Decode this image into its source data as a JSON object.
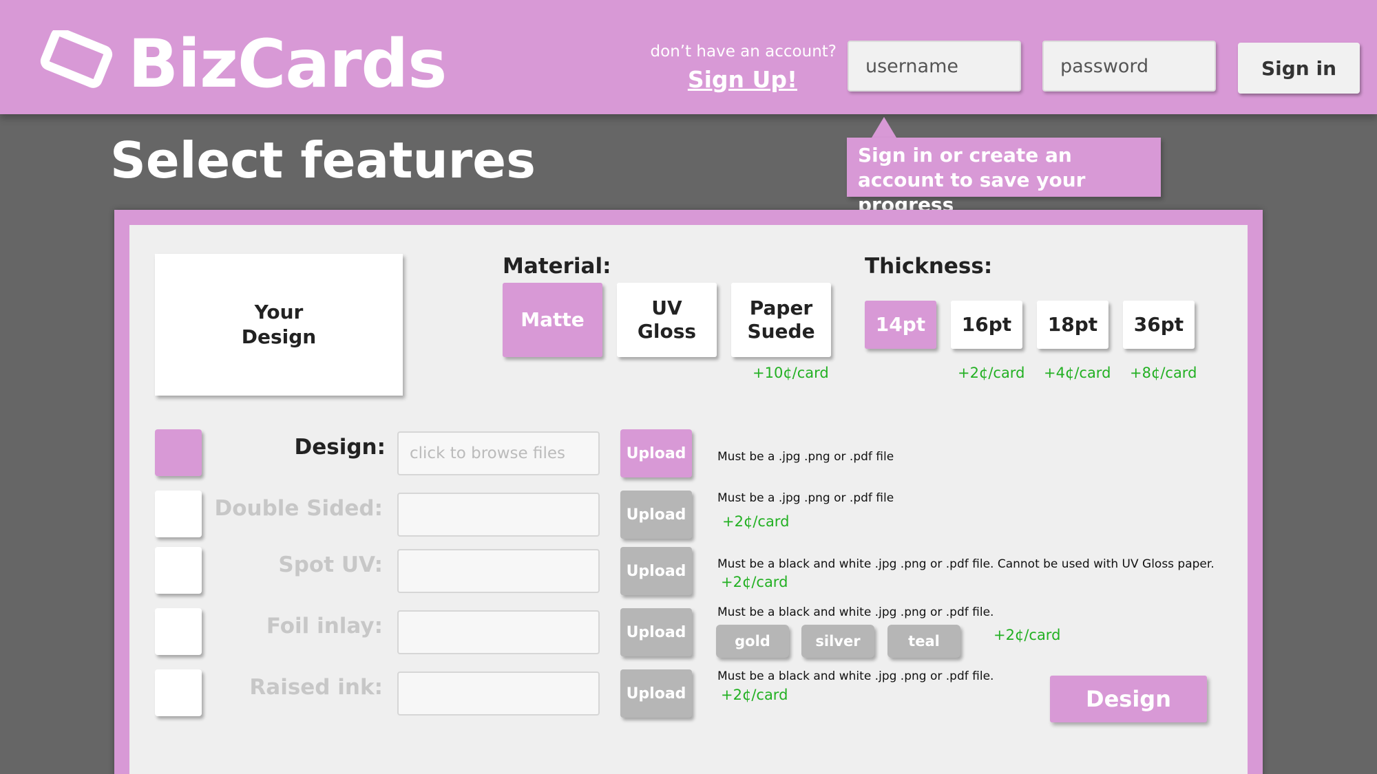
{
  "header": {
    "logo_text": "BizCards",
    "no_account_text": "don’t have an account?",
    "signup_label": "Sign Up!",
    "username_placeholder": "username",
    "password_placeholder": "password",
    "signin_label": "Sign in"
  },
  "page_title": "Select features",
  "tooltip": "Sign in or create an account to save your progress",
  "preview_label": "Your\nDesign",
  "material": {
    "label": "Material:",
    "options": [
      {
        "label": "Matte",
        "price": "",
        "selected": true
      },
      {
        "label": "UV\nGloss",
        "price": "",
        "selected": false
      },
      {
        "label": "Paper\nSuede",
        "price": "+10¢/card",
        "selected": false
      }
    ]
  },
  "thickness": {
    "label": "Thickness:",
    "options": [
      {
        "label": "14pt",
        "price": "",
        "selected": true
      },
      {
        "label": "16pt",
        "price": "+2¢/card",
        "selected": false
      },
      {
        "label": "18pt",
        "price": "+4¢/card",
        "selected": false
      },
      {
        "label": "36pt",
        "price": "+8¢/card",
        "selected": false
      }
    ]
  },
  "features": [
    {
      "label": "Design:",
      "checked": true,
      "placeholder": "click to browse files",
      "upload": "Upload",
      "note": "Must be a .jpg .png or .pdf file",
      "price": ""
    },
    {
      "label": "Double Sided:",
      "checked": false,
      "placeholder": "",
      "upload": "Upload",
      "note": "Must be a .jpg .png or .pdf file",
      "price": "+2¢/card"
    },
    {
      "label": "Spot UV:",
      "checked": false,
      "placeholder": "",
      "upload": "Upload",
      "note": "Must be a black and white .jpg .png or .pdf file. Cannot be used with UV Gloss paper.",
      "price": "+2¢/card"
    },
    {
      "label": "Foil inlay:",
      "checked": false,
      "placeholder": "",
      "upload": "Upload",
      "note": "Must be a black and white .jpg .png or .pdf file.",
      "price": "+2¢/card"
    },
    {
      "label": "Raised ink:",
      "checked": false,
      "placeholder": "",
      "upload": "Upload",
      "note": "Must be a black and white .jpg .png or .pdf file.",
      "price": "+2¢/card"
    }
  ],
  "foil_colors": [
    "gold",
    "silver",
    "teal"
  ],
  "design_button": "Design",
  "colors": {
    "accent": "#d899d6",
    "background": "#666666",
    "panel": "#efefef",
    "price": "#22b022",
    "disabled": "#b6b6b6"
  }
}
